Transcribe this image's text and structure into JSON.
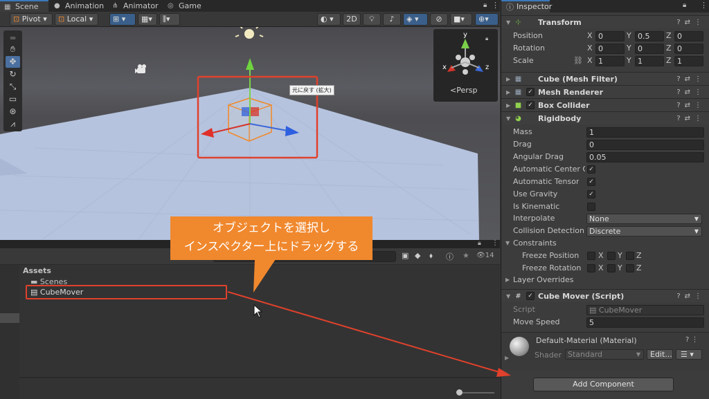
{
  "tabs": {
    "scene": "Scene",
    "animation": "Animation",
    "animator": "Animator",
    "game": "Game"
  },
  "scene_toolbar": {
    "pivot": "Pivot",
    "local": "Local",
    "twod": "2D"
  },
  "viewport": {
    "persp_label": "Persp",
    "gizmo_axis_y": "y",
    "gizmo_axis_x": "x",
    "gizmo_axis_z": "z",
    "tooltip": "元に戻す (拡大)"
  },
  "project": {
    "assets_title": "Assets",
    "items": [
      {
        "label": "Scenes"
      },
      {
        "label": "CubeMover"
      }
    ],
    "count": "14"
  },
  "callout": {
    "line1": "オブジェクトを選択し",
    "line2": "インスペクター上にドラッグする"
  },
  "inspector": {
    "title": "Inspector",
    "transform": {
      "title": "Transform",
      "position_label": "Position",
      "rotation_label": "Rotation",
      "scale_label": "Scale",
      "position": [
        "0",
        "0.5",
        "0"
      ],
      "rotation": [
        "0",
        "0",
        "0"
      ],
      "scale": [
        "1",
        "1",
        "1"
      ],
      "axis_x": "X",
      "axis_y": "Y",
      "axis_z": "Z"
    },
    "mesh_filter": "Cube (Mesh Filter)",
    "mesh_renderer": "Mesh Renderer",
    "box_collider": "Box Collider",
    "rigidbody": {
      "title": "Rigidbody",
      "mass_label": "Mass",
      "mass": "1",
      "drag_label": "Drag",
      "drag": "0",
      "angular_drag_label": "Angular Drag",
      "angular_drag": "0.05",
      "auto_center_label": "Automatic Center Of M",
      "auto_tensor_label": "Automatic Tensor",
      "use_gravity_label": "Use Gravity",
      "is_kinematic_label": "Is Kinematic",
      "interpolate_label": "Interpolate",
      "interpolate": "None",
      "collision_label": "Collision Detection",
      "collision": "Discrete",
      "constraints_label": "Constraints",
      "freeze_pos_label": "Freeze Position",
      "freeze_rot_label": "Freeze Rotation",
      "layer_overrides_label": "Layer Overrides"
    },
    "cube_mover": {
      "title": "Cube Mover (Script)",
      "script_label": "Script",
      "script_value": "CubeMover",
      "move_speed_label": "Move Speed",
      "move_speed": "5"
    },
    "material": {
      "title": "Default-Material (Material)",
      "shader_label": "Shader",
      "shader_value": "Standard",
      "edit_label": "Edit..."
    },
    "add_component": "Add Component"
  },
  "colors": {
    "accent_orange": "#f0882e",
    "highlight_red": "#e0412c",
    "selection_blue": "#3a79bb"
  }
}
